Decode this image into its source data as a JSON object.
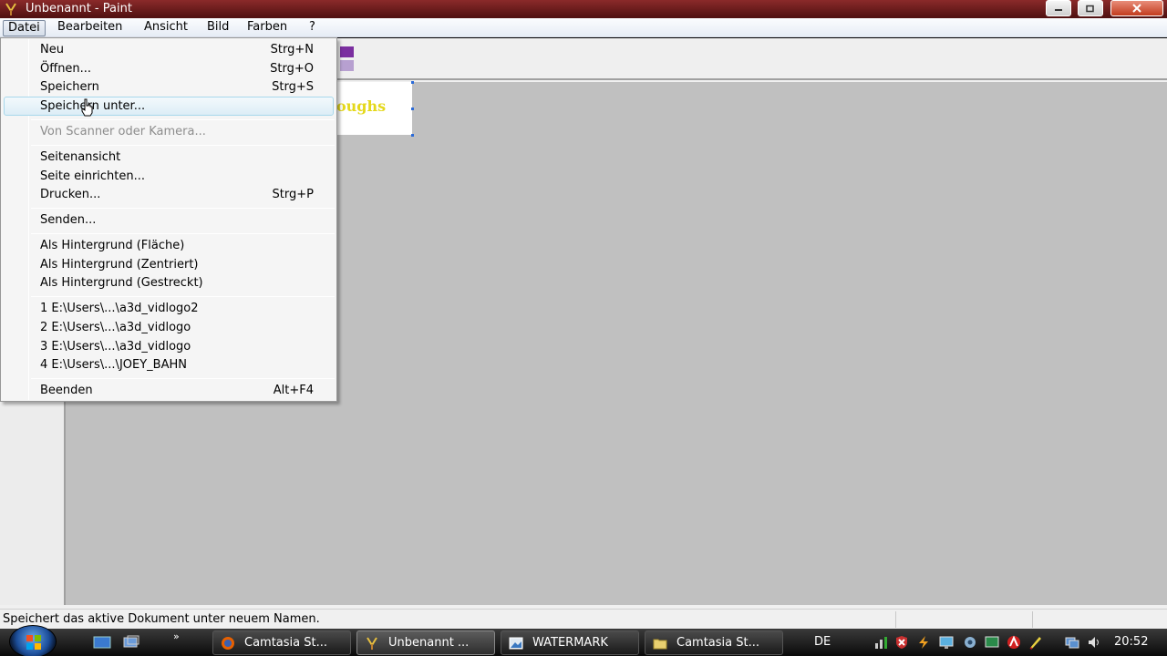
{
  "window": {
    "title": "Unbenannt - Paint",
    "app_icon": "paint-icon"
  },
  "menubar": {
    "items": [
      "Datei",
      "Bearbeiten",
      "Ansicht",
      "Bild",
      "Farben",
      "?"
    ],
    "active": "Datei"
  },
  "file_menu": {
    "items": [
      {
        "label": "Neu",
        "shortcut": "Strg+N"
      },
      {
        "label": "Öffnen...",
        "shortcut": "Strg+O"
      },
      {
        "label": "Speichern",
        "shortcut": "Strg+S"
      },
      {
        "label": "Speichern unter...",
        "shortcut": ""
      },
      {
        "label": "Von Scanner oder Kamera...",
        "shortcut": "",
        "disabled": true
      },
      {
        "label": "Seitenansicht",
        "shortcut": ""
      },
      {
        "label": "Seite einrichten...",
        "shortcut": ""
      },
      {
        "label": "Drucken...",
        "shortcut": "Strg+P"
      },
      {
        "label": "Senden...",
        "shortcut": ""
      },
      {
        "label": "Als Hintergrund (Fläche)",
        "shortcut": ""
      },
      {
        "label": "Als Hintergrund (Zentriert)",
        "shortcut": ""
      },
      {
        "label": "Als Hintergrund (Gestreckt)",
        "shortcut": ""
      },
      {
        "label": "1 E:\\Users\\...\\a3d_vidlogo2",
        "shortcut": ""
      },
      {
        "label": "2 E:\\Users\\...\\a3d_vidlogo",
        "shortcut": ""
      },
      {
        "label": "3 E:\\Users\\...\\a3d_vidlogo",
        "shortcut": ""
      },
      {
        "label": "4 E:\\Users\\...\\JOEY_BAHN",
        "shortcut": ""
      },
      {
        "label": "Beenden",
        "shortcut": "Alt+F4"
      }
    ],
    "hovered": "Speichern unter..."
  },
  "canvas": {
    "text_fragment": "oughs"
  },
  "colors": {
    "title_bar": "#6a1a1a",
    "canvas_bg": "#c0c0c0",
    "text_color": "#e4d81b",
    "swatch_dark": "#7b2fa0",
    "swatch_light": "#b7a0d0"
  },
  "statusbar": {
    "text": "Speichert das aktive Dokument unter neuem Namen."
  },
  "taskbar": {
    "tasks": [
      {
        "label": "Camtasia St...",
        "icon": "firefox-icon"
      },
      {
        "label": "Unbenannt ...",
        "icon": "paint-icon",
        "active": true
      },
      {
        "label": "WATERMARK",
        "icon": "image-icon"
      },
      {
        "label": "Camtasia St...",
        "icon": "folder-icon"
      }
    ],
    "language": "DE",
    "clock": "20:52"
  }
}
